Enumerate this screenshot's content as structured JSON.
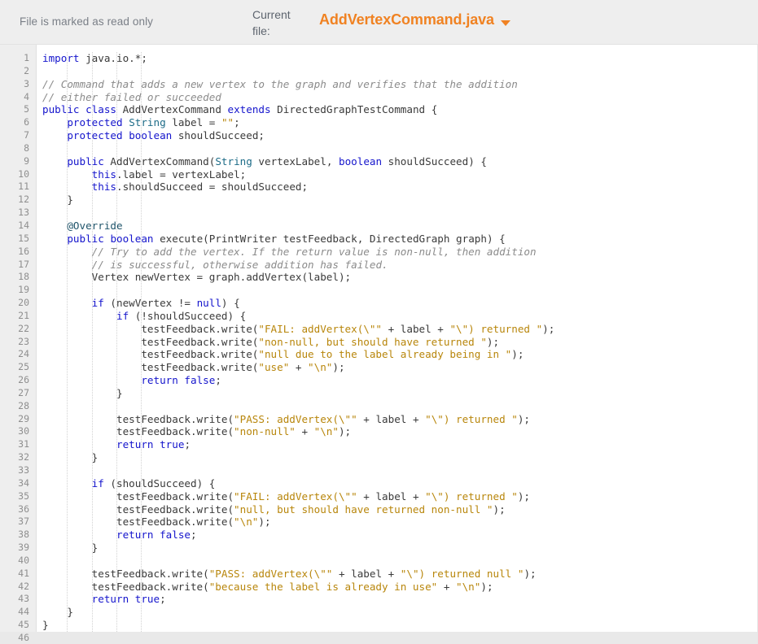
{
  "header": {
    "readonly_notice": "File is marked as read only",
    "current_file_label": "Current file:",
    "file_name": "AddVertexCommand.java",
    "caret_icon": "chevron-down-icon",
    "accent_color": "#f08222",
    "background_color": "#eeeeee"
  },
  "editor": {
    "language": "java",
    "theme_colors": {
      "keyword": "#1414cc",
      "type": "#1c6b87",
      "string": "#b8860b",
      "comment": "#8b8b8b",
      "annotation": "#20556b",
      "plain": "#3a3a3a",
      "gutter_background": "#eeeeee",
      "gutter_text": "#8f8f8f",
      "active_line": "#e9e9e9"
    },
    "active_line_number": 46,
    "total_lines": 46,
    "lines": [
      {
        "n": 1,
        "tokens": [
          {
            "c": "k",
            "v": "import"
          },
          {
            "c": "p",
            "v": " java.io.*;"
          }
        ]
      },
      {
        "n": 2,
        "tokens": []
      },
      {
        "n": 3,
        "tokens": [
          {
            "c": "c",
            "v": "// Command that adds a new vertex to the graph and verifies that the addition"
          }
        ]
      },
      {
        "n": 4,
        "tokens": [
          {
            "c": "c",
            "v": "// either failed or succeeded"
          }
        ]
      },
      {
        "n": 5,
        "tokens": [
          {
            "c": "k",
            "v": "public"
          },
          {
            "c": "p",
            "v": " "
          },
          {
            "c": "k",
            "v": "class"
          },
          {
            "c": "p",
            "v": " AddVertexCommand "
          },
          {
            "c": "k",
            "v": "extends"
          },
          {
            "c": "p",
            "v": " DirectedGraphTestCommand {"
          }
        ]
      },
      {
        "n": 6,
        "tokens": [
          {
            "c": "p",
            "v": "    "
          },
          {
            "c": "k",
            "v": "protected"
          },
          {
            "c": "p",
            "v": " "
          },
          {
            "c": "t",
            "v": "String"
          },
          {
            "c": "p",
            "v": " label = "
          },
          {
            "c": "s",
            "v": "\"\""
          },
          {
            "c": "p",
            "v": ";"
          }
        ]
      },
      {
        "n": 7,
        "tokens": [
          {
            "c": "p",
            "v": "    "
          },
          {
            "c": "k",
            "v": "protected"
          },
          {
            "c": "p",
            "v": " "
          },
          {
            "c": "k",
            "v": "boolean"
          },
          {
            "c": "p",
            "v": " shouldSucceed;"
          }
        ]
      },
      {
        "n": 8,
        "tokens": []
      },
      {
        "n": 9,
        "tokens": [
          {
            "c": "p",
            "v": "    "
          },
          {
            "c": "k",
            "v": "public"
          },
          {
            "c": "p",
            "v": " AddVertexCommand("
          },
          {
            "c": "t",
            "v": "String"
          },
          {
            "c": "p",
            "v": " vertexLabel, "
          },
          {
            "c": "k",
            "v": "boolean"
          },
          {
            "c": "p",
            "v": " shouldSucceed) {"
          }
        ]
      },
      {
        "n": 10,
        "tokens": [
          {
            "c": "p",
            "v": "        "
          },
          {
            "c": "k",
            "v": "this"
          },
          {
            "c": "p",
            "v": ".label = vertexLabel;"
          }
        ]
      },
      {
        "n": 11,
        "tokens": [
          {
            "c": "p",
            "v": "        "
          },
          {
            "c": "k",
            "v": "this"
          },
          {
            "c": "p",
            "v": ".shouldSucceed = shouldSucceed;"
          }
        ]
      },
      {
        "n": 12,
        "tokens": [
          {
            "c": "p",
            "v": "    }"
          }
        ]
      },
      {
        "n": 13,
        "tokens": []
      },
      {
        "n": 14,
        "tokens": [
          {
            "c": "p",
            "v": "    "
          },
          {
            "c": "a",
            "v": "@Override"
          }
        ]
      },
      {
        "n": 15,
        "tokens": [
          {
            "c": "p",
            "v": "    "
          },
          {
            "c": "k",
            "v": "public"
          },
          {
            "c": "p",
            "v": " "
          },
          {
            "c": "k",
            "v": "boolean"
          },
          {
            "c": "p",
            "v": " execute(PrintWriter testFeedback, DirectedGraph graph) {"
          }
        ]
      },
      {
        "n": 16,
        "tokens": [
          {
            "c": "p",
            "v": "        "
          },
          {
            "c": "c",
            "v": "// Try to add the vertex. If the return value is non-null, then addition"
          }
        ]
      },
      {
        "n": 17,
        "tokens": [
          {
            "c": "p",
            "v": "        "
          },
          {
            "c": "c",
            "v": "// is successful, otherwise addition has failed."
          }
        ]
      },
      {
        "n": 18,
        "tokens": [
          {
            "c": "p",
            "v": "        Vertex newVertex = graph.addVertex(label);"
          }
        ]
      },
      {
        "n": 19,
        "tokens": []
      },
      {
        "n": 20,
        "tokens": [
          {
            "c": "p",
            "v": "        "
          },
          {
            "c": "k",
            "v": "if"
          },
          {
            "c": "p",
            "v": " (newVertex != "
          },
          {
            "c": "k",
            "v": "null"
          },
          {
            "c": "p",
            "v": ") {"
          }
        ]
      },
      {
        "n": 21,
        "tokens": [
          {
            "c": "p",
            "v": "            "
          },
          {
            "c": "k",
            "v": "if"
          },
          {
            "c": "p",
            "v": " (!shouldSucceed) {"
          }
        ]
      },
      {
        "n": 22,
        "tokens": [
          {
            "c": "p",
            "v": "                testFeedback.write("
          },
          {
            "c": "s",
            "v": "\"FAIL: addVertex(\\\"\""
          },
          {
            "c": "p",
            "v": " + label + "
          },
          {
            "c": "s",
            "v": "\"\\\") returned \""
          },
          {
            "c": "p",
            "v": ");"
          }
        ]
      },
      {
        "n": 23,
        "tokens": [
          {
            "c": "p",
            "v": "                testFeedback.write("
          },
          {
            "c": "s",
            "v": "\"non-null, but should have returned \""
          },
          {
            "c": "p",
            "v": ");"
          }
        ]
      },
      {
        "n": 24,
        "tokens": [
          {
            "c": "p",
            "v": "                testFeedback.write("
          },
          {
            "c": "s",
            "v": "\"null due to the label already being in \""
          },
          {
            "c": "p",
            "v": ");"
          }
        ]
      },
      {
        "n": 25,
        "tokens": [
          {
            "c": "p",
            "v": "                testFeedback.write("
          },
          {
            "c": "s",
            "v": "\"use\""
          },
          {
            "c": "p",
            "v": " + "
          },
          {
            "c": "s",
            "v": "\"\\n\""
          },
          {
            "c": "p",
            "v": ");"
          }
        ]
      },
      {
        "n": 26,
        "tokens": [
          {
            "c": "p",
            "v": "                "
          },
          {
            "c": "k",
            "v": "return"
          },
          {
            "c": "p",
            "v": " "
          },
          {
            "c": "k",
            "v": "false"
          },
          {
            "c": "p",
            "v": ";"
          }
        ]
      },
      {
        "n": 27,
        "tokens": [
          {
            "c": "p",
            "v": "            }"
          }
        ]
      },
      {
        "n": 28,
        "tokens": []
      },
      {
        "n": 29,
        "tokens": [
          {
            "c": "p",
            "v": "            testFeedback.write("
          },
          {
            "c": "s",
            "v": "\"PASS: addVertex(\\\"\""
          },
          {
            "c": "p",
            "v": " + label + "
          },
          {
            "c": "s",
            "v": "\"\\\") returned \""
          },
          {
            "c": "p",
            "v": ");"
          }
        ]
      },
      {
        "n": 30,
        "tokens": [
          {
            "c": "p",
            "v": "            testFeedback.write("
          },
          {
            "c": "s",
            "v": "\"non-null\""
          },
          {
            "c": "p",
            "v": " + "
          },
          {
            "c": "s",
            "v": "\"\\n\""
          },
          {
            "c": "p",
            "v": ");"
          }
        ]
      },
      {
        "n": 31,
        "tokens": [
          {
            "c": "p",
            "v": "            "
          },
          {
            "c": "k",
            "v": "return"
          },
          {
            "c": "p",
            "v": " "
          },
          {
            "c": "k",
            "v": "true"
          },
          {
            "c": "p",
            "v": ";"
          }
        ]
      },
      {
        "n": 32,
        "tokens": [
          {
            "c": "p",
            "v": "        }"
          }
        ]
      },
      {
        "n": 33,
        "tokens": []
      },
      {
        "n": 34,
        "tokens": [
          {
            "c": "p",
            "v": "        "
          },
          {
            "c": "k",
            "v": "if"
          },
          {
            "c": "p",
            "v": " (shouldSucceed) {"
          }
        ]
      },
      {
        "n": 35,
        "tokens": [
          {
            "c": "p",
            "v": "            testFeedback.write("
          },
          {
            "c": "s",
            "v": "\"FAIL: addVertex(\\\"\""
          },
          {
            "c": "p",
            "v": " + label + "
          },
          {
            "c": "s",
            "v": "\"\\\") returned \""
          },
          {
            "c": "p",
            "v": ");"
          }
        ]
      },
      {
        "n": 36,
        "tokens": [
          {
            "c": "p",
            "v": "            testFeedback.write("
          },
          {
            "c": "s",
            "v": "\"null, but should have returned non-null \""
          },
          {
            "c": "p",
            "v": ");"
          }
        ]
      },
      {
        "n": 37,
        "tokens": [
          {
            "c": "p",
            "v": "            testFeedback.write("
          },
          {
            "c": "s",
            "v": "\"\\n\""
          },
          {
            "c": "p",
            "v": ");"
          }
        ]
      },
      {
        "n": 38,
        "tokens": [
          {
            "c": "p",
            "v": "            "
          },
          {
            "c": "k",
            "v": "return"
          },
          {
            "c": "p",
            "v": " "
          },
          {
            "c": "k",
            "v": "false"
          },
          {
            "c": "p",
            "v": ";"
          }
        ]
      },
      {
        "n": 39,
        "tokens": [
          {
            "c": "p",
            "v": "        }"
          }
        ]
      },
      {
        "n": 40,
        "tokens": []
      },
      {
        "n": 41,
        "tokens": [
          {
            "c": "p",
            "v": "        testFeedback.write("
          },
          {
            "c": "s",
            "v": "\"PASS: addVertex(\\\"\""
          },
          {
            "c": "p",
            "v": " + label + "
          },
          {
            "c": "s",
            "v": "\"\\\") returned null \""
          },
          {
            "c": "p",
            "v": ");"
          }
        ]
      },
      {
        "n": 42,
        "tokens": [
          {
            "c": "p",
            "v": "        testFeedback.write("
          },
          {
            "c": "s",
            "v": "\"because the label is already in use\""
          },
          {
            "c": "p",
            "v": " + "
          },
          {
            "c": "s",
            "v": "\"\\n\""
          },
          {
            "c": "p",
            "v": ");"
          }
        ]
      },
      {
        "n": 43,
        "tokens": [
          {
            "c": "p",
            "v": "        "
          },
          {
            "c": "k",
            "v": "return"
          },
          {
            "c": "p",
            "v": " "
          },
          {
            "c": "k",
            "v": "true"
          },
          {
            "c": "p",
            "v": ";"
          }
        ]
      },
      {
        "n": 44,
        "tokens": [
          {
            "c": "p",
            "v": "    }"
          }
        ]
      },
      {
        "n": 45,
        "tokens": [
          {
            "c": "p",
            "v": "}"
          }
        ]
      },
      {
        "n": 46,
        "tokens": []
      }
    ]
  }
}
